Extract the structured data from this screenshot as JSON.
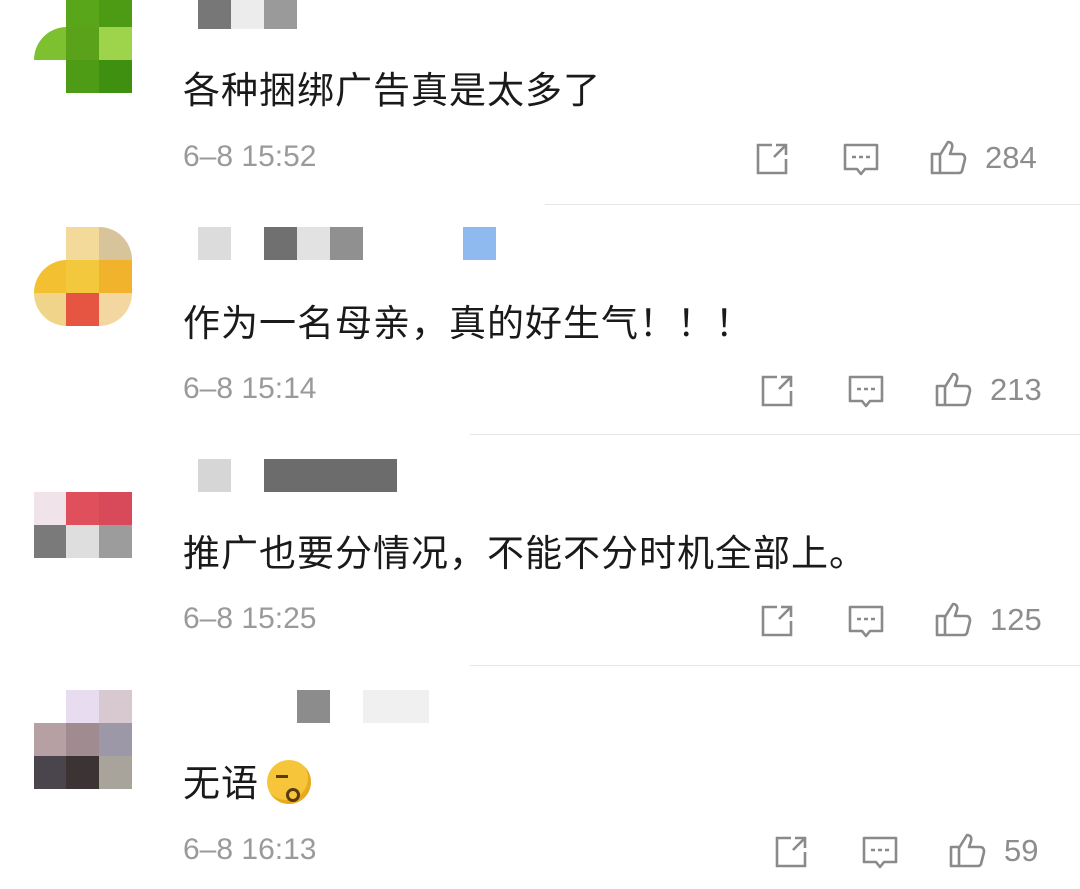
{
  "comments": [
    {
      "text": "各种捆绑广告真是太多了",
      "time": "6–8 15:52",
      "likes": "284",
      "avatar_colors": [
        "#5aa61a",
        "#4d9a14",
        "#7dc030",
        "#9ed44c",
        "#5aa21a",
        "#3f8f10"
      ]
    },
    {
      "text": "作为一名母亲，真的好生气！！！",
      "time": "6–8 15:14",
      "likes": "213",
      "avatar_colors": [
        "#f3d99a",
        "#d8c49a",
        "#f4c83c",
        "#f2b32c",
        "#e65442"
      ]
    },
    {
      "text": "推广也要分情况，不能不分时机全部上。",
      "time": "6–8 15:25",
      "likes": "125",
      "avatar_colors": [
        "#f0e4ea",
        "#e0505c",
        "#d84a5a",
        "#7a7a7a",
        "#dedede",
        "#9c9c9c"
      ]
    },
    {
      "text": "无语",
      "time": "6–8 16:13",
      "likes": "59",
      "avatar_colors": [
        "#e8dcf0",
        "#d8c8d0",
        "#b7a0a4",
        "#a08c90",
        "#9c98a8",
        "#4a454c",
        "#3c3434",
        "#a8a49c"
      ]
    }
  ],
  "icons": {
    "share": "share-icon",
    "comment": "comment-icon",
    "like": "like-icon"
  }
}
